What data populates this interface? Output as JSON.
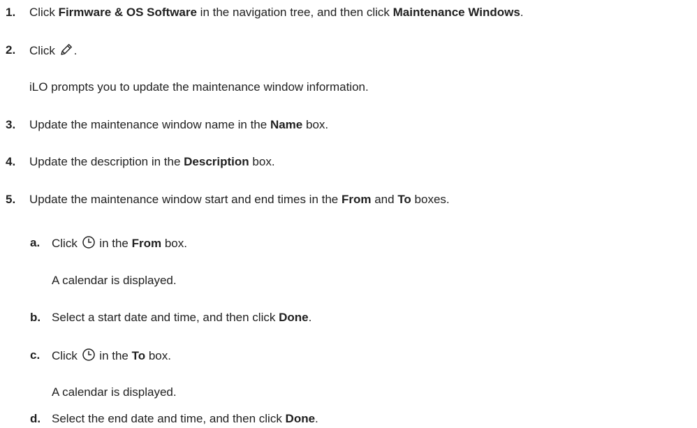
{
  "steps": [
    {
      "num": "1.",
      "pre": "Click ",
      "b1": "Firmware & OS Software",
      "mid": " in the navigation tree, and then click ",
      "b2": "Maintenance Windows",
      "post": "."
    },
    {
      "num": "2.",
      "pre": "Click ",
      "post": "."
    },
    {
      "note": "iLO prompts you to update the maintenance window information."
    },
    {
      "num": "3.",
      "pre": "Update the maintenance window name in the ",
      "b1": "Name",
      "post": " box."
    },
    {
      "num": "4.",
      "pre": "Update the description in the ",
      "b1": "Description",
      "post": " box."
    },
    {
      "num": "5.",
      "pre": "Update the maintenance window start and end times in the ",
      "b1": "From",
      "mid": " and ",
      "b2": "To",
      "post": " boxes."
    }
  ],
  "substeps": [
    {
      "num": "a.",
      "pre": "Click ",
      "mid": " in the ",
      "b1": "From",
      "post": " box.",
      "note": "A calendar is displayed."
    },
    {
      "num": "b.",
      "pre": "Select a start date and time, and then click ",
      "b1": "Done",
      "post": "."
    },
    {
      "num": "c.",
      "pre": "Click ",
      "mid": " in the ",
      "b1": "To",
      "post": " box.",
      "note": "A calendar is displayed."
    },
    {
      "num": "d.",
      "pre": "Select the end date and time, and then click ",
      "b1": "Done",
      "post": "."
    }
  ],
  "icons": {
    "edit": "pencil-edit-icon",
    "clock": "clock-icon"
  }
}
